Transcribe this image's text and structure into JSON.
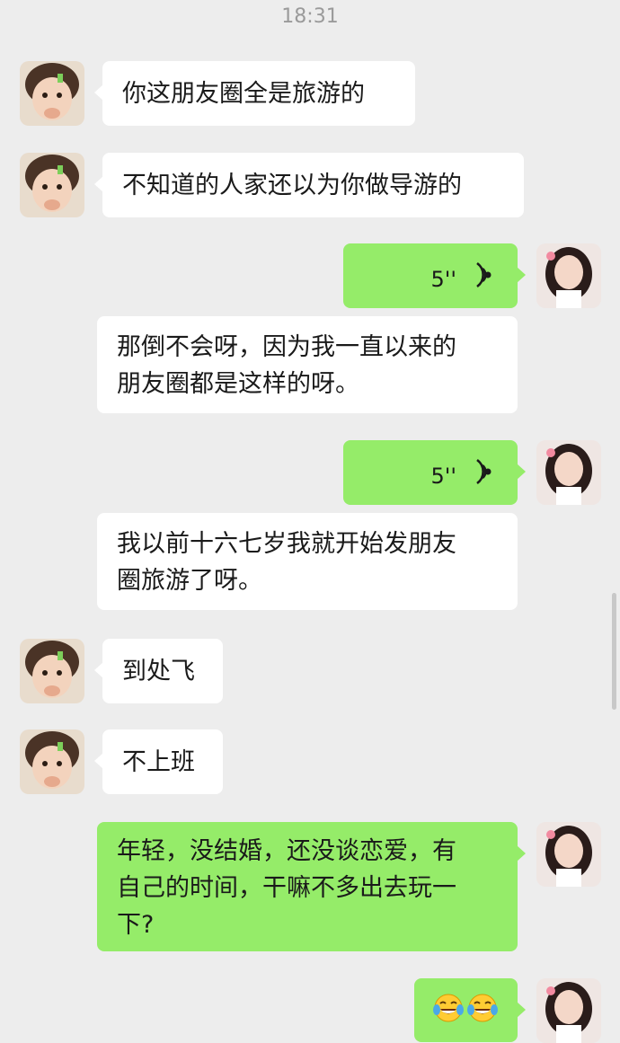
{
  "status": {
    "time": "18:31"
  },
  "messages": [
    {
      "side": "left",
      "text": "你这朋友圈全是旅游的"
    },
    {
      "side": "left",
      "text": "不知道的人家还以为你做导游的"
    },
    {
      "side": "right",
      "kind": "voice",
      "duration": "5''",
      "transcript": [
        "那倒不会呀，因为我一直以来的",
        "朋友圈都是这样的呀。"
      ]
    },
    {
      "side": "right",
      "kind": "voice",
      "duration": "5''",
      "transcript": [
        "我以前十六七岁我就开始发朋友",
        "圈旅游了呀。"
      ]
    },
    {
      "side": "left",
      "text": "到处飞"
    },
    {
      "side": "left",
      "text": "不上班"
    },
    {
      "side": "right",
      "lines": [
        "年轻，没结婚，还没谈恋爱，有",
        "自己的时间，干嘛不多出去玩一",
        "下?"
      ]
    },
    {
      "side": "right",
      "kind": "emoji",
      "emoji": [
        "face-with-tears-of-joy",
        "face-with-tears-of-joy"
      ]
    }
  ],
  "colors": {
    "background": "#ededed",
    "sent_bubble": "#95ec69",
    "received_bubble": "#ffffff"
  }
}
